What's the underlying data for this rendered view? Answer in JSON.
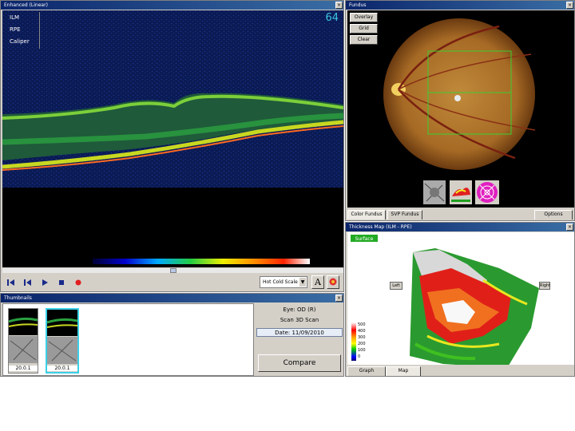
{
  "scan_window": {
    "title": "Enhanced (Linear)",
    "overlays": [
      "ILM",
      "RPE",
      "Caliper"
    ],
    "frame_number": "64",
    "playback": {
      "buttons": [
        "skip-back",
        "step-back",
        "play",
        "stop",
        "record"
      ],
      "display_mode": "Hot Cold Scale"
    }
  },
  "fundus_window": {
    "title": "Fundus",
    "buttons": [
      "Overlay",
      "Grid",
      "Clear"
    ],
    "thumbnails": [
      "gray-fundus",
      "thickness-map",
      "etdrs-grid"
    ],
    "tabs": [
      "Color Fundus",
      "SVP Fundus",
      "Options"
    ]
  },
  "thickness_window": {
    "title": "Thickness Map (ILM - RPE)",
    "surface_label": "Surface",
    "side_labels": [
      "Left",
      "Right"
    ],
    "legend_values": [
      "500",
      "400",
      "300",
      "200",
      "100",
      "0"
    ],
    "tabs": [
      "Graph",
      "Map"
    ]
  },
  "thumbnails_window": {
    "title": "Thumbnails",
    "items": [
      "20.0.1",
      "20.0.1"
    ],
    "info_lines": [
      "Eye: OD (R)",
      "Scan 3D Scan",
      "Date: 11/09/2010"
    ],
    "compare_label": "Compare"
  },
  "colors": {
    "titlebar": "#0a246a",
    "window_bg": "#d4d0c8",
    "surface_green": "#22aa22"
  }
}
